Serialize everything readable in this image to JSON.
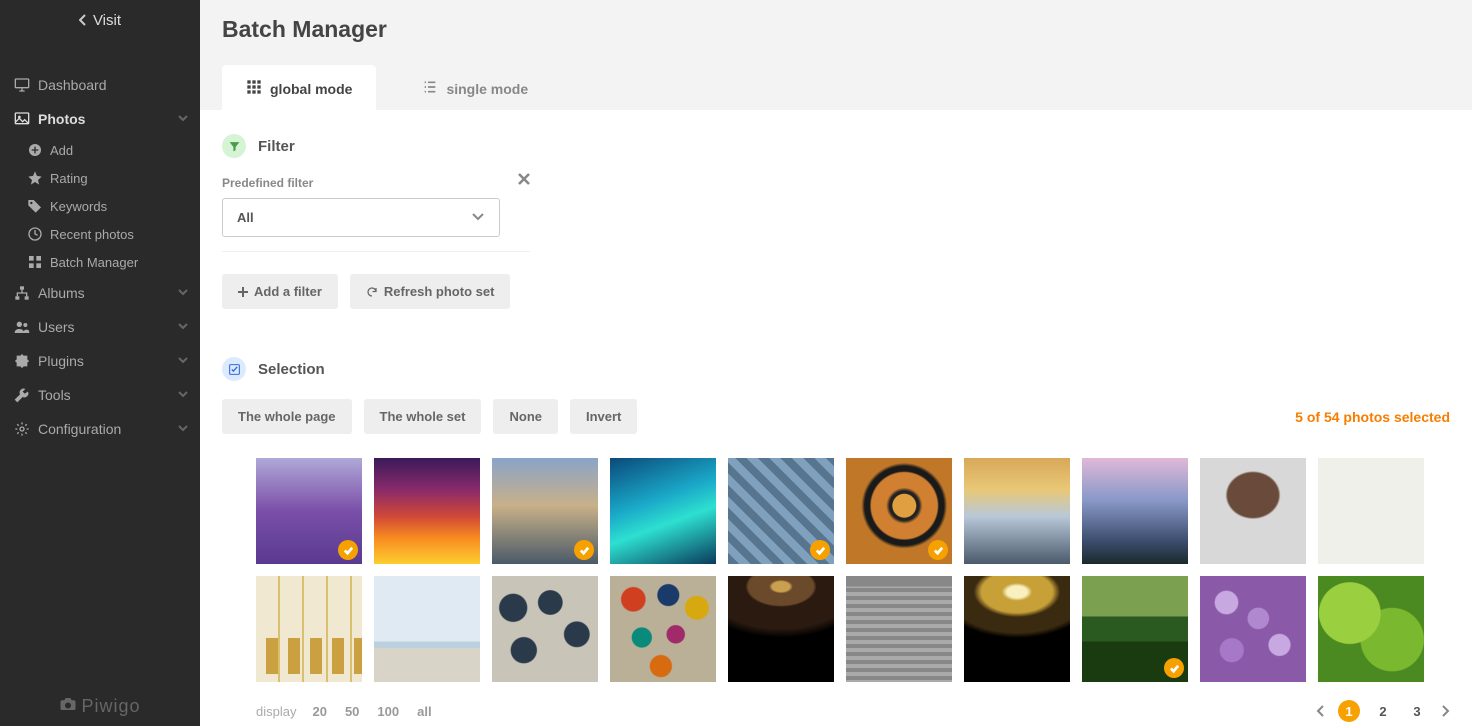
{
  "visit_label": "Visit",
  "page_title": "Batch Manager",
  "logo": "Piwigo",
  "sidebar": [
    {
      "label": "Dashboard",
      "icon": "monitor"
    },
    {
      "label": "Photos",
      "icon": "image",
      "expandable": true,
      "open": true,
      "active": true,
      "children": [
        {
          "label": "Add",
          "icon": "plus-circle"
        },
        {
          "label": "Rating",
          "icon": "star"
        },
        {
          "label": "Keywords",
          "icon": "tags"
        },
        {
          "label": "Recent photos",
          "icon": "clock"
        },
        {
          "label": "Batch Manager",
          "icon": "grid"
        }
      ]
    },
    {
      "label": "Albums",
      "icon": "sitemap",
      "expandable": true
    },
    {
      "label": "Users",
      "icon": "users",
      "expandable": true
    },
    {
      "label": "Plugins",
      "icon": "puzzle",
      "expandable": true
    },
    {
      "label": "Tools",
      "icon": "wrench",
      "expandable": true
    },
    {
      "label": "Configuration",
      "icon": "gear",
      "expandable": true
    }
  ],
  "tabs": [
    {
      "label": "global mode",
      "active": true
    },
    {
      "label": "single mode",
      "active": false
    }
  ],
  "filter": {
    "heading": "Filter",
    "predefined_label": "Predefined filter",
    "predefined_value": "All",
    "add_filter": "Add a filter",
    "refresh": "Refresh photo set"
  },
  "selection": {
    "heading": "Selection",
    "buttons": [
      "The whole page",
      "The whole set",
      "None",
      "Invert"
    ],
    "count_text": "5 of 54 photos selected"
  },
  "thumbs_selected": [
    true,
    false,
    true,
    false,
    true,
    true,
    false,
    false,
    false,
    false,
    false,
    false,
    false,
    false,
    false,
    false,
    false,
    true,
    false,
    false
  ],
  "display": {
    "label": "display",
    "options": [
      "20",
      "50",
      "100",
      "all"
    ]
  },
  "pagination": {
    "current": 1,
    "pages": [
      1,
      2,
      3
    ]
  }
}
